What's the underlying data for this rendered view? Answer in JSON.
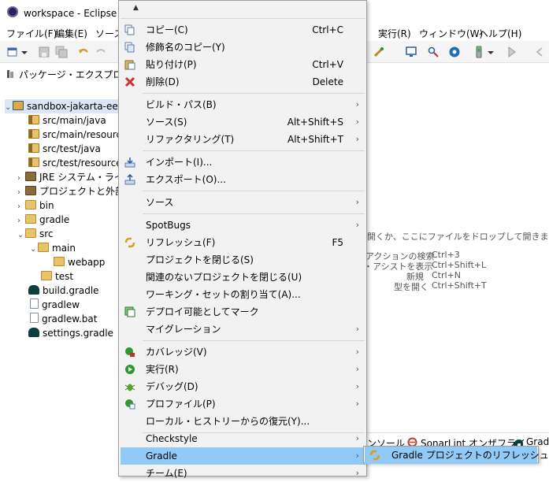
{
  "window": {
    "title": "workspace - Eclipse プ"
  },
  "menubar": {
    "items": [
      "ファイル(F)",
      "編集(E)",
      "ソース",
      "実行(R)",
      "ウィンドウ(W)",
      "ヘルプ(H)"
    ]
  },
  "explorer": {
    "title": "パッケージ・エクスプローラー",
    "tree": [
      {
        "label": "sandbox-jakarta-ee",
        "icon": "project-icon",
        "expanded": "open"
      },
      {
        "label": "src/main/java",
        "icon": "source-folder-icon"
      },
      {
        "label": "src/main/resourc",
        "icon": "source-folder-icon"
      },
      {
        "label": "src/test/java",
        "icon": "source-folder-icon"
      },
      {
        "label": "src/test/resources",
        "icon": "source-folder-icon"
      },
      {
        "label": "JRE システム・ライブ",
        "icon": "library-icon",
        "expanded": "closed"
      },
      {
        "label": "プロジェクトと外部の",
        "icon": "library-icon",
        "expanded": "closed"
      },
      {
        "label": "bin",
        "icon": "folder-icon",
        "expanded": "closed"
      },
      {
        "label": "gradle",
        "icon": "folder-icon",
        "expanded": "closed"
      },
      {
        "label": "src",
        "icon": "folder-icon",
        "expanded": "open"
      },
      {
        "label": "main",
        "icon": "folder-icon",
        "expanded": "open"
      },
      {
        "label": "webapp",
        "icon": "folder-icon"
      },
      {
        "label": "test",
        "icon": "folder-icon"
      },
      {
        "label": "build.gradle",
        "icon": "gradle-icon"
      },
      {
        "label": "gradlew",
        "icon": "file-icon"
      },
      {
        "label": "gradlew.bat",
        "icon": "file-icon"
      },
      {
        "label": "settings.gradle",
        "icon": "gradle-icon"
      }
    ]
  },
  "editor": {
    "drop_hint": "開くか、ここにファイルをドロップして開きます。",
    "shortcuts": [
      {
        "label": "アクションの検索",
        "key": "Ctrl+3"
      },
      {
        "label": "・アシストを表示",
        "key": "Ctrl+Shift+L"
      },
      {
        "label": "新規",
        "key": "Ctrl+N"
      },
      {
        "label": "型を開く",
        "key": "Ctrl+Shift+T"
      }
    ]
  },
  "bottom_tabs": {
    "console": "ンソール",
    "sonarlint": "SonarLint オンザフライ",
    "gradle": "Grad"
  },
  "context_menu": {
    "scroll_up": "▲",
    "items": [
      {
        "label": "コピー(C)",
        "accel": "Ctrl+C",
        "icon": "copy-icon"
      },
      {
        "label": "修飾名のコピー(Y)",
        "accel": "",
        "icon": "copy-qualified-icon"
      },
      {
        "label": "貼り付け(P)",
        "accel": "Ctrl+V",
        "icon": "paste-icon"
      },
      {
        "label": "削除(D)",
        "accel": "Delete",
        "icon": "delete-icon"
      },
      {
        "label": "ビルド・パス(B)",
        "accel": "",
        "submenu": true
      },
      {
        "label": "ソース(S)",
        "accel": "Alt+Shift+S",
        "submenu": true
      },
      {
        "label": "リファクタリング(T)",
        "accel": "Alt+Shift+T",
        "submenu": true
      },
      {
        "label": "インポート(I)...",
        "accel": "",
        "icon": "import-icon"
      },
      {
        "label": "エクスポート(O)...",
        "accel": "",
        "icon": "export-icon"
      },
      {
        "label": "ソース",
        "accel": "",
        "submenu": true
      },
      {
        "label": "SpotBugs",
        "accel": "",
        "submenu": true
      },
      {
        "label": "リフレッシュ(F)",
        "accel": "F5",
        "icon": "refresh-icon"
      },
      {
        "label": "プロジェクトを閉じる(S)",
        "accel": ""
      },
      {
        "label": "関連のないプロジェクトを閉じる(U)",
        "accel": ""
      },
      {
        "label": "ワーキング・セットの割り当て(A)...",
        "accel": ""
      },
      {
        "label": "デプロイ可能としてマーク",
        "accel": "",
        "icon": "deploy-icon"
      },
      {
        "label": "マイグレーション",
        "accel": "",
        "submenu": true
      },
      {
        "label": "カバレッジ(V)",
        "accel": "",
        "icon": "coverage-icon",
        "submenu": true
      },
      {
        "label": "実行(R)",
        "accel": "",
        "icon": "run-icon",
        "submenu": true
      },
      {
        "label": "デバッグ(D)",
        "accel": "",
        "icon": "debug-icon",
        "submenu": true
      },
      {
        "label": "プロファイル(P)",
        "accel": "",
        "icon": "profile-icon",
        "submenu": true
      },
      {
        "label": "ローカル・ヒストリーからの復元(Y)...",
        "accel": ""
      },
      {
        "label": "Checkstyle",
        "accel": "",
        "submenu": true
      },
      {
        "label": "Gradle",
        "accel": "",
        "submenu": true,
        "selected": true
      },
      {
        "label": "チーム(E)",
        "accel": "",
        "submenu": true
      }
    ]
  },
  "submenu": {
    "label": "Gradle プロジェクトのリフレッシュ",
    "icon": "gradle-refresh-icon"
  }
}
